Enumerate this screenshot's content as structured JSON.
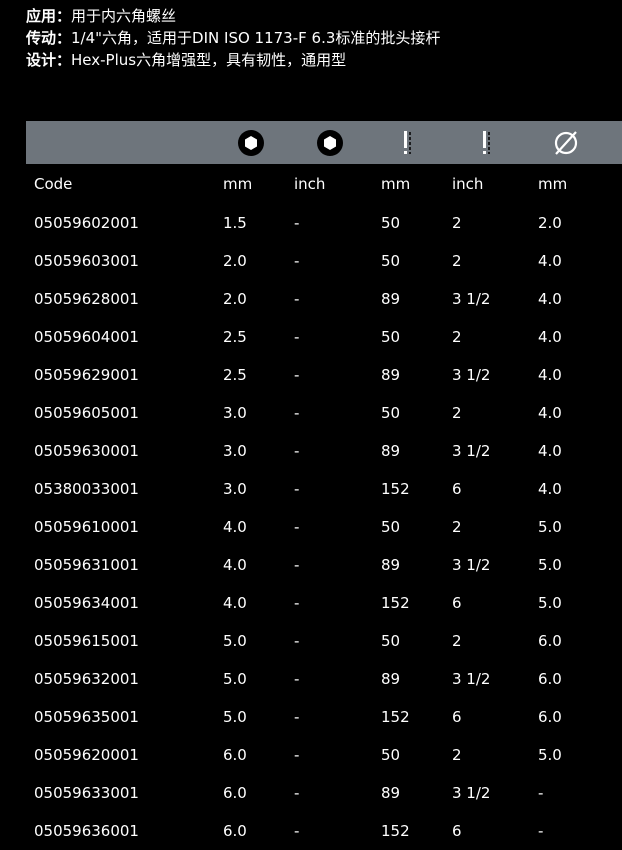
{
  "specs": [
    {
      "key": "应用：",
      "value": "用于内六角螺丝"
    },
    {
      "key": "传动：",
      "value": "1/4\"六角，适用于DIN ISO 1173-F 6.3标准的批头接杆"
    },
    {
      "key": "设计：",
      "value": "Hex-Plus六角增强型，具有韧性，通用型"
    }
  ],
  "icons": [
    "hex-socket-icon",
    "hex-socket-icon",
    "length-icon",
    "length-icon",
    "diameter-icon"
  ],
  "headers": [
    "Code",
    "mm",
    "inch",
    "mm",
    "inch",
    "mm"
  ],
  "rows": [
    [
      "05059602001",
      "1.5",
      "-",
      "50",
      "2",
      "2.0"
    ],
    [
      "05059603001",
      "2.0",
      "-",
      "50",
      "2",
      "4.0"
    ],
    [
      "05059628001",
      "2.0",
      "-",
      "89",
      "3 1/2",
      "4.0"
    ],
    [
      "05059604001",
      "2.5",
      "-",
      "50",
      "2",
      "4.0"
    ],
    [
      "05059629001",
      "2.5",
      "-",
      "89",
      "3 1/2",
      "4.0"
    ],
    [
      "05059605001",
      "3.0",
      "-",
      "50",
      "2",
      "4.0"
    ],
    [
      "05059630001",
      "3.0",
      "-",
      "89",
      "3 1/2",
      "4.0"
    ],
    [
      "05380033001",
      "3.0",
      "-",
      "152",
      "6",
      "4.0"
    ],
    [
      "05059610001",
      "4.0",
      "-",
      "50",
      "2",
      "5.0"
    ],
    [
      "05059631001",
      "4.0",
      "-",
      "89",
      "3 1/2",
      "5.0"
    ],
    [
      "05059634001",
      "4.0",
      "-",
      "152",
      "6",
      "5.0"
    ],
    [
      "05059615001",
      "5.0",
      "-",
      "50",
      "2",
      "6.0"
    ],
    [
      "05059632001",
      "5.0",
      "-",
      "89",
      "3 1/2",
      "6.0"
    ],
    [
      "05059635001",
      "5.0",
      "-",
      "152",
      "6",
      "6.0"
    ],
    [
      "05059620001",
      "6.0",
      "-",
      "50",
      "2",
      "5.0"
    ],
    [
      "05059633001",
      "6.0",
      "-",
      "89",
      "3 1/2",
      "-"
    ],
    [
      "05059636001",
      "6.0",
      "-",
      "152",
      "6",
      "-"
    ]
  ]
}
